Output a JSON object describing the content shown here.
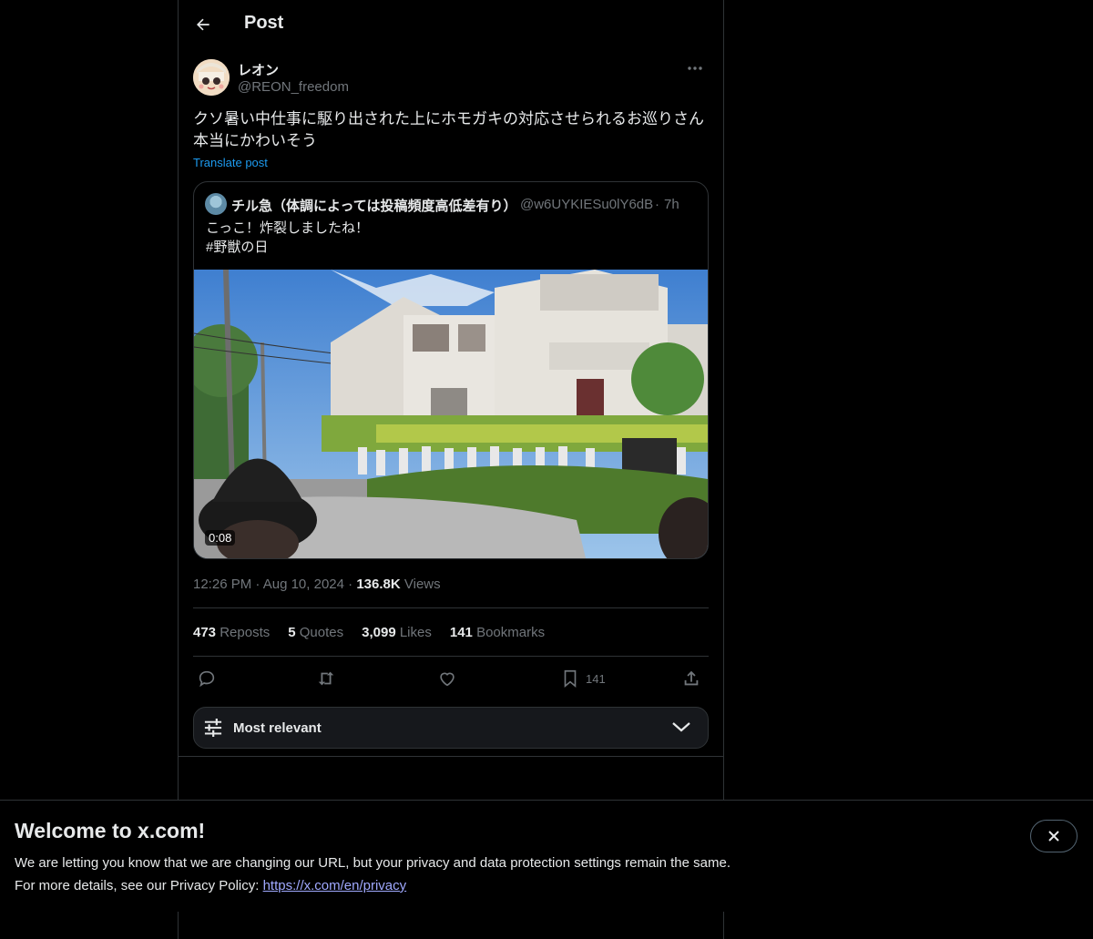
{
  "header": {
    "title": "Post"
  },
  "post": {
    "author_name": "レオン",
    "author_handle": "@REON_freedom",
    "text": "クソ暑い中仕事に駆り出された上にホモガキの対応させられるお巡りさん\n本当にかわいそう",
    "translate_label": "Translate post",
    "time": "12:26 PM",
    "date": "Aug 10, 2024",
    "views_count": "136.8K",
    "views_label": "Views"
  },
  "quote": {
    "author_name": "チル急（体調によっては投稿頻度高低差有り）",
    "author_handle": "@w6UYKIESu0lY6dB",
    "separator": "·",
    "time": "7h",
    "text": "こっこ！炸裂しましたね！\n#野獣の日",
    "video_duration": "0:08"
  },
  "stats": {
    "reposts_count": "473",
    "reposts_label": "Reposts",
    "quotes_count": "5",
    "quotes_label": "Quotes",
    "likes_count": "3,099",
    "likes_label": "Likes",
    "bookmarks_count": "141",
    "bookmarks_label": "Bookmarks"
  },
  "actions": {
    "bookmark_count": "141"
  },
  "sort": {
    "label": "Most relevant"
  },
  "banner": {
    "title": "Welcome to x.com!",
    "line1": "We are letting you know that we are changing our URL, but your privacy and data protection settings remain the same.",
    "line2_prefix": "For more details, see our Privacy Policy: ",
    "link": "https://x.com/en/privacy"
  },
  "colors": {
    "accent": "#1d9bf0",
    "muted": "#71767b",
    "border": "#2f3336",
    "link": "#a0a9ff"
  }
}
